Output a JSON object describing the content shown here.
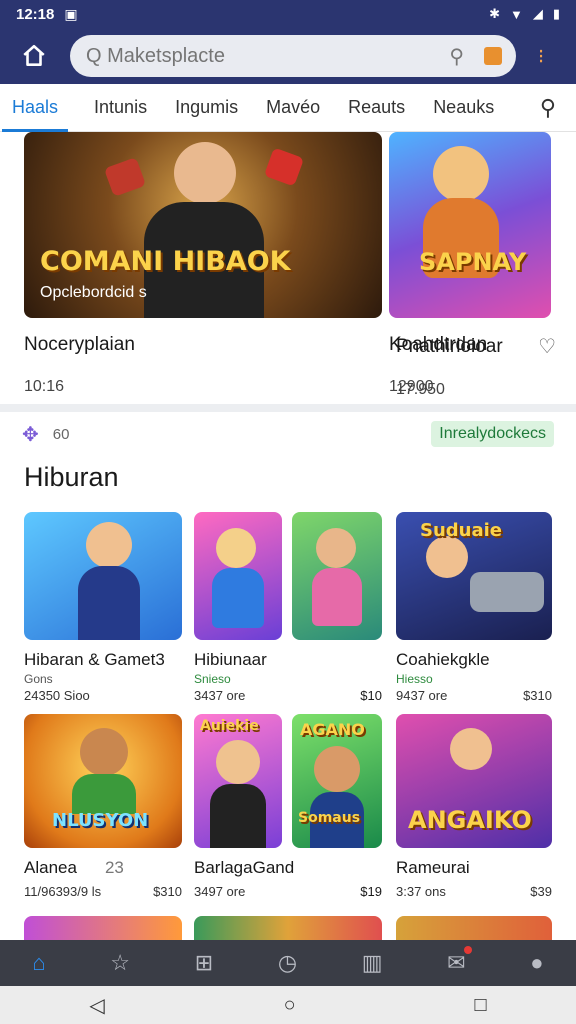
{
  "status": {
    "time": "12:18"
  },
  "search": {
    "placeholder": "Q Maketsplacte"
  },
  "tabs": [
    {
      "label": "Haals"
    },
    {
      "label": "Intunis"
    },
    {
      "label": "Ingumis"
    },
    {
      "label": "Mavéo"
    },
    {
      "label": "Reauts"
    },
    {
      "label": "Neauks"
    }
  ],
  "hero": [
    {
      "art_title": "COMANI HIBAOK",
      "art_sub": "Opclebordcid s",
      "title": "Noceryplaian",
      "meta": "10:16"
    },
    {
      "art_title": "SAPNAY",
      "title": "Koahdtrdan",
      "meta": "12900"
    },
    {
      "title": "Pnathirloioar",
      "meta": "17.950"
    }
  ],
  "section": {
    "count": "60",
    "badge": "Inrealydockecs",
    "title": "Hiburan"
  },
  "grid": [
    {
      "title": "Hibaran & Gamet3",
      "sub": "Gons",
      "meta": "24350 Sioo",
      "price": ""
    },
    {
      "title": "Hibiunaar",
      "sub": "Snieso",
      "meta": "3437 ore",
      "price": ""
    },
    {
      "title": "",
      "sub": "",
      "meta": "",
      "price": "$10"
    },
    {
      "title": "Coahiekgkle",
      "sub": "Hiesso",
      "meta": "9437 ore",
      "price": "$310",
      "art_title": "Suduaie"
    },
    {
      "title": "Alanea",
      "sub": "",
      "meta": "11/96393/9 ls",
      "price": "$310",
      "extra": "23",
      "art_title": "NLUSYON"
    },
    {
      "title": "BarlagaGand",
      "sub": "",
      "meta": "3497 ore",
      "price": "",
      "art_title": "Auiekie"
    },
    {
      "title": "",
      "sub": "",
      "meta": "",
      "price": "$19",
      "art_title": "AGANO",
      "art_sub": "Somaus"
    },
    {
      "title": "Rameurai",
      "sub": "",
      "meta": "3:37 ons",
      "price": "$39",
      "art_title": "ANGAIKO"
    }
  ],
  "colors": {
    "appbar": "#2b3570",
    "accent": "#1b7bd6",
    "badge_bg": "#dcf3e0"
  }
}
